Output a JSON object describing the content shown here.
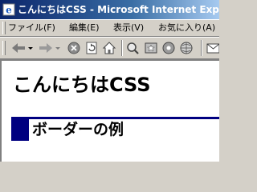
{
  "window": {
    "title": "こんにちはCSS - Microsoft Internet Explorer"
  },
  "menubar": {
    "items": [
      {
        "label": "ファイル(F)"
      },
      {
        "label": "編集(E)"
      },
      {
        "label": "表示(V)"
      },
      {
        "label": "お気に入り(A)"
      }
    ]
  },
  "toolbar": {
    "buttons": [
      {
        "icon": "back-arrow-icon"
      },
      {
        "icon": "dropdown-arrow-icon"
      },
      {
        "icon": "forward-arrow-icon"
      },
      {
        "icon": "dropdown-arrow-icon"
      },
      {
        "icon": "stop-icon"
      },
      {
        "icon": "refresh-icon"
      },
      {
        "icon": "home-icon"
      },
      {
        "icon": "search-icon"
      },
      {
        "icon": "favorites-icon"
      },
      {
        "icon": "media-icon"
      },
      {
        "icon": "history-icon"
      },
      {
        "icon": "mail-icon"
      }
    ]
  },
  "content": {
    "heading": "こんにちはCSS",
    "border_example": "ボーダーの例"
  },
  "colors": {
    "title_bar_start": "#0a246a",
    "title_bar_end": "#a6caf0",
    "border_accent": "#000080",
    "chrome": "#d4d0c8"
  }
}
